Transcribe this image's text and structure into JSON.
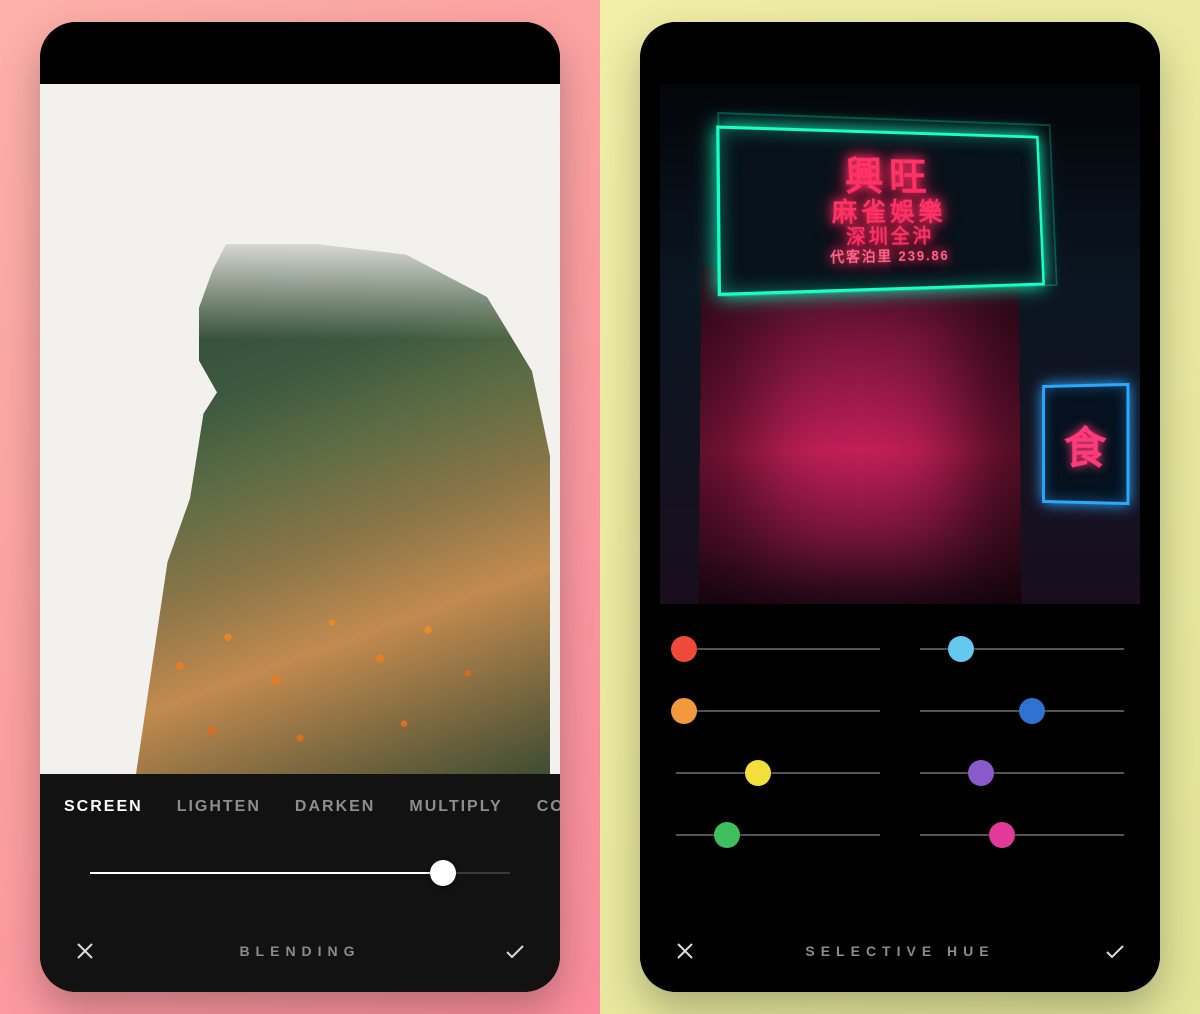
{
  "left": {
    "title": "BLENDING",
    "tabs": [
      {
        "label": "SCREEN",
        "active": true
      },
      {
        "label": "LIGHTEN",
        "active": false
      },
      {
        "label": "DARKEN",
        "active": false
      },
      {
        "label": "MULTIPLY",
        "active": false
      },
      {
        "label": "COLORBURN",
        "active": false
      }
    ],
    "slider": {
      "value_pct": 84,
      "thumb_color": "#ffffff",
      "fill_color": "#ffffff"
    }
  },
  "right": {
    "title": "SELECTIVE HUE",
    "sign": {
      "line1": "興旺",
      "line2": "麻雀娛樂",
      "line3": "深圳全沖",
      "line4": "代客泊里 239.86",
      "side": "食"
    },
    "sliders": [
      {
        "name": "red",
        "color": "#ef4a39",
        "value_pct": 4
      },
      {
        "name": "cyan",
        "color": "#65c8ef",
        "value_pct": 20
      },
      {
        "name": "orange",
        "color": "#f29a3b",
        "value_pct": 4
      },
      {
        "name": "blue",
        "color": "#2f72cf",
        "value_pct": 55
      },
      {
        "name": "yellow",
        "color": "#f2df3a",
        "value_pct": 40
      },
      {
        "name": "purple",
        "color": "#8a5acb",
        "value_pct": 30
      },
      {
        "name": "green",
        "color": "#3fbe5d",
        "value_pct": 25
      },
      {
        "name": "magenta",
        "color": "#e23a98",
        "value_pct": 40
      }
    ]
  },
  "colors": {
    "tab_active": "#ffffff",
    "tab_inactive": "#8d8d8d",
    "panel_title": "#8b8b8b",
    "track": "#3a3a3a"
  }
}
